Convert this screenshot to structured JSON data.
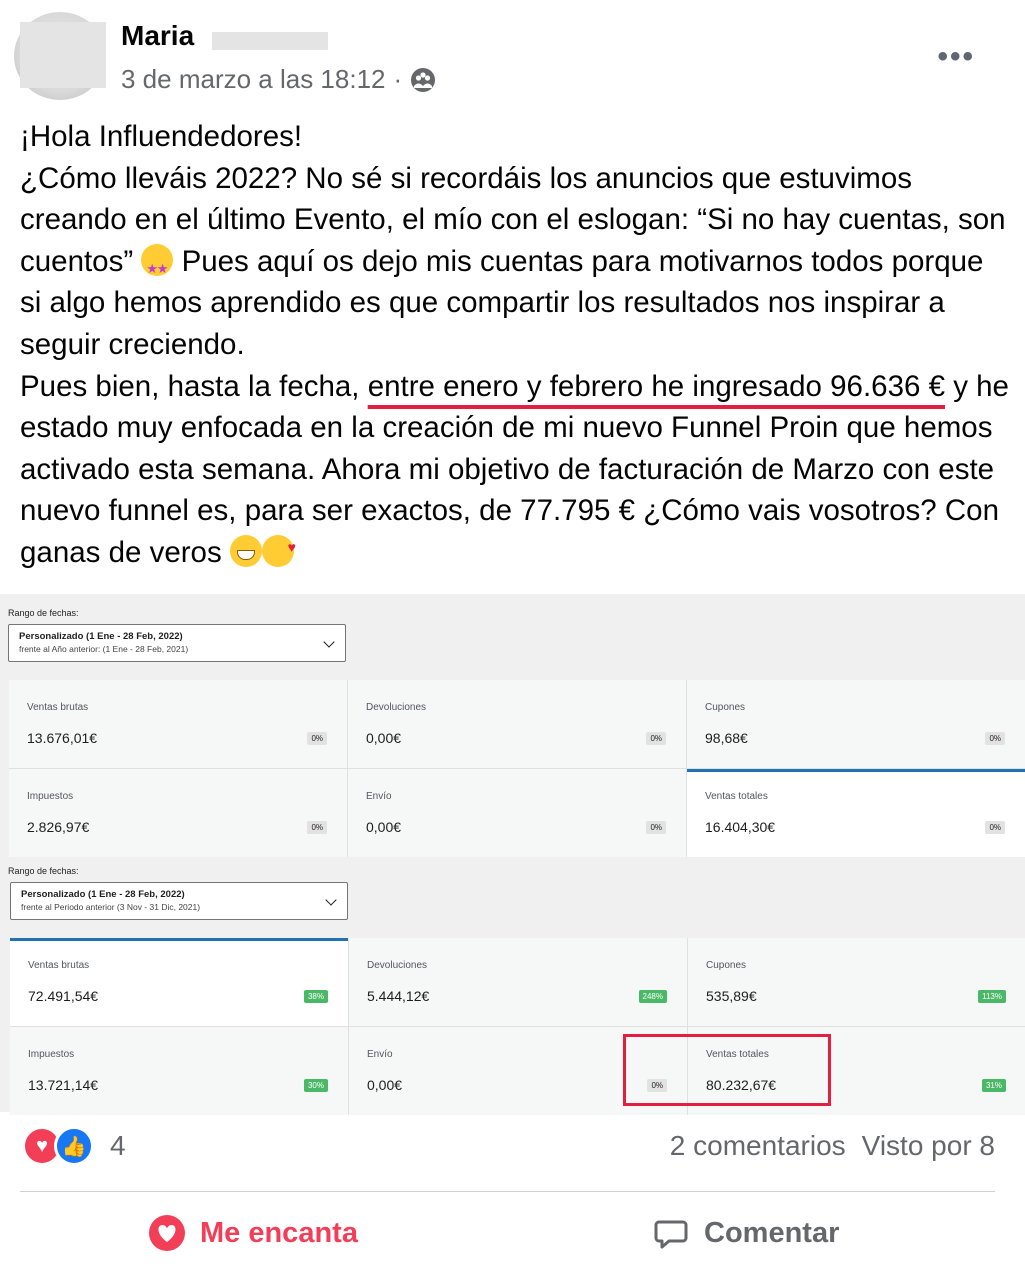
{
  "post": {
    "author_name": "Maria",
    "timestamp": "3 de marzo a las 18:12",
    "separator": "·",
    "audience_icon": "friends-icon",
    "more_label": "•••",
    "text": {
      "line1": "¡Hola Influendedores!",
      "p2": "¿Cómo lleváis 2022? No sé si recordáis los anuncios que estuvimos creando en el último Evento, el mío con el eslogan: “Si no hay cuentas, son cuentos”",
      "p2b": "Pues aquí os dejo mis cuentas para motivarnos todos porque si algo hemos aprendido es que compartir los resultados nos inspirar a seguir creciendo.",
      "p3_before": "Pues bien, hasta la fecha,",
      "p3_underlined": "entre enero y febrero he ingresado 96.636 €",
      "p3_after": "y he estado muy enfocada en la creación de mi nuevo Funnel Proin que hemos activado esta semana. Ahora mi objetivo de facturación de Marzo con este nuevo funnel es, para ser exactos, de 77.795 € ¿Cómo vais vosotros? Con ganas de veros"
    }
  },
  "dashboard": {
    "sections": [
      {
        "range_label": "Rango de fechas:",
        "range_main": "Personalizado (1 Ene - 28 Feb, 2022)",
        "range_sub": "frente al Año anterior: (1 Ene - 28 Feb, 2021)",
        "cards": [
          {
            "label": "Ventas brutas",
            "value": "13.676,01€",
            "change": "0%"
          },
          {
            "label": "Devoluciones",
            "value": "0,00€",
            "change": "0%"
          },
          {
            "label": "Cupones",
            "value": "98,68€",
            "change": "0%"
          },
          {
            "label": "Impuestos",
            "value": "2.826,97€",
            "change": "0%"
          },
          {
            "label": "Envío",
            "value": "0,00€",
            "change": "0%"
          },
          {
            "label": "Ventas totales",
            "value": "16.404,30€",
            "change": "0%"
          }
        ]
      },
      {
        "range_label": "Rango de fechas:",
        "range_main": "Personalizado (1 Ene - 28 Feb, 2022)",
        "range_sub": "frente al Periodo anterior (3 Nov - 31 Dic, 2021)",
        "cards": [
          {
            "label": "Ventas brutas",
            "value": "72.491,54€",
            "change": "38%"
          },
          {
            "label": "Devoluciones",
            "value": "5.444,12€",
            "change": "248%"
          },
          {
            "label": "Cupones",
            "value": "535,89€",
            "change": "113%"
          },
          {
            "label": "Impuestos",
            "value": "13.721,14€",
            "change": "30%"
          },
          {
            "label": "Envío",
            "value": "0,00€",
            "change": "0%"
          },
          {
            "label": "Ventas totales",
            "value": "80.232,67€",
            "change": "31%"
          }
        ]
      }
    ]
  },
  "footer": {
    "reaction_count": "4",
    "comments": "2 comentarios",
    "views": "Visto por 8",
    "love_label": "Me encanta",
    "comment_label": "Comentar"
  },
  "colors": {
    "accent_red": "#e41e3f",
    "love": "#f33e58",
    "like": "#1877f2",
    "badge_green": "#4ab866",
    "selected_blue": "#2271b1"
  }
}
